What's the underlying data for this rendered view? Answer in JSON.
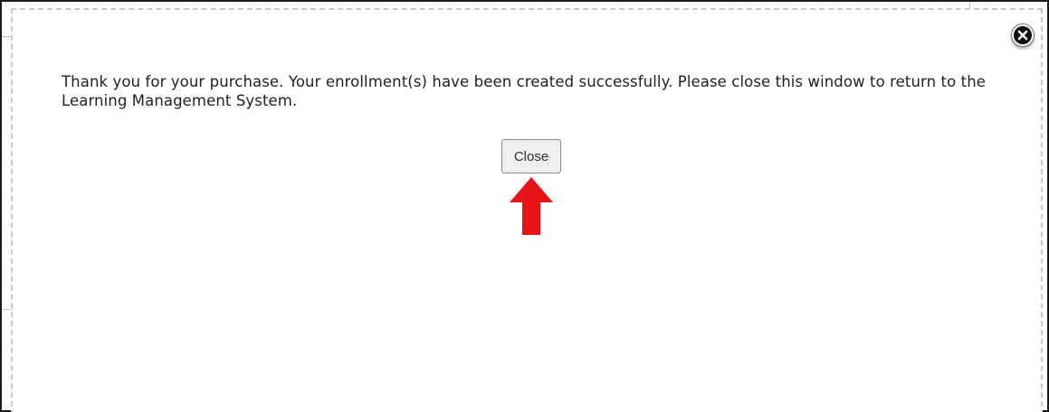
{
  "dialog": {
    "message": "Thank you for your purchase. Your enrollment(s) have been created successfully. Please close this window to return to the Learning Management System.",
    "close_button_label": "Close",
    "close_icon": "close-x-icon"
  },
  "annotation": {
    "arrow_icon": "arrow-up-icon",
    "arrow_color": "#e8141a"
  },
  "colors": {
    "background": "#ffffff",
    "text": "#222222",
    "modal_border": "#c9c9c9"
  }
}
